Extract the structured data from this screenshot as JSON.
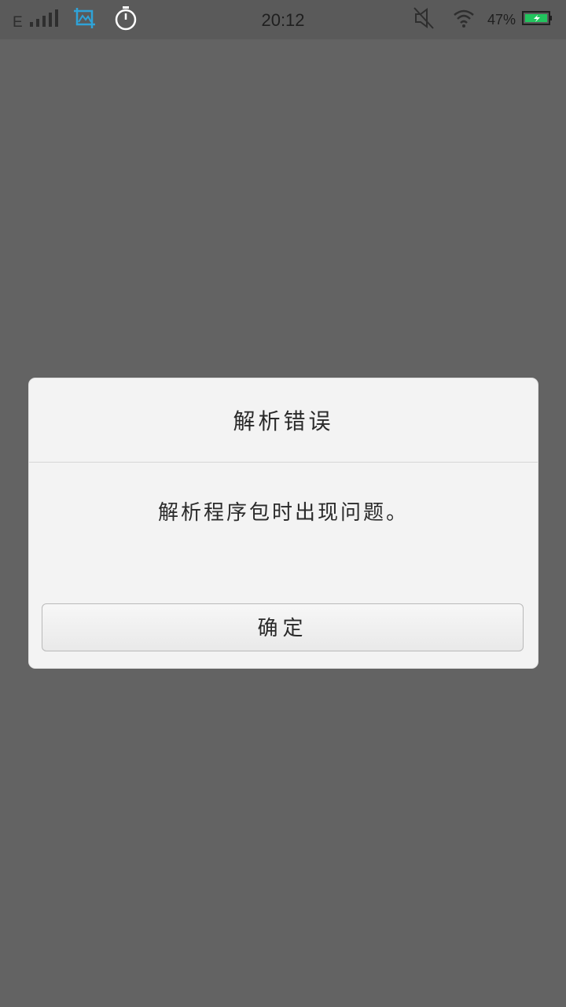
{
  "status_bar": {
    "network_type": "E",
    "time": "20:12",
    "battery_percent": "47%",
    "icons": [
      "signal-icon",
      "screenshot-icon",
      "stopwatch-icon",
      "mute-icon",
      "wifi-icon",
      "battery-charging-icon"
    ],
    "accent_color": "#2fa3d8",
    "battery_color": "#22c55e"
  },
  "dialog": {
    "title": "解析错误",
    "message": "解析程序包时出现问题。",
    "confirm_label": "确定"
  }
}
